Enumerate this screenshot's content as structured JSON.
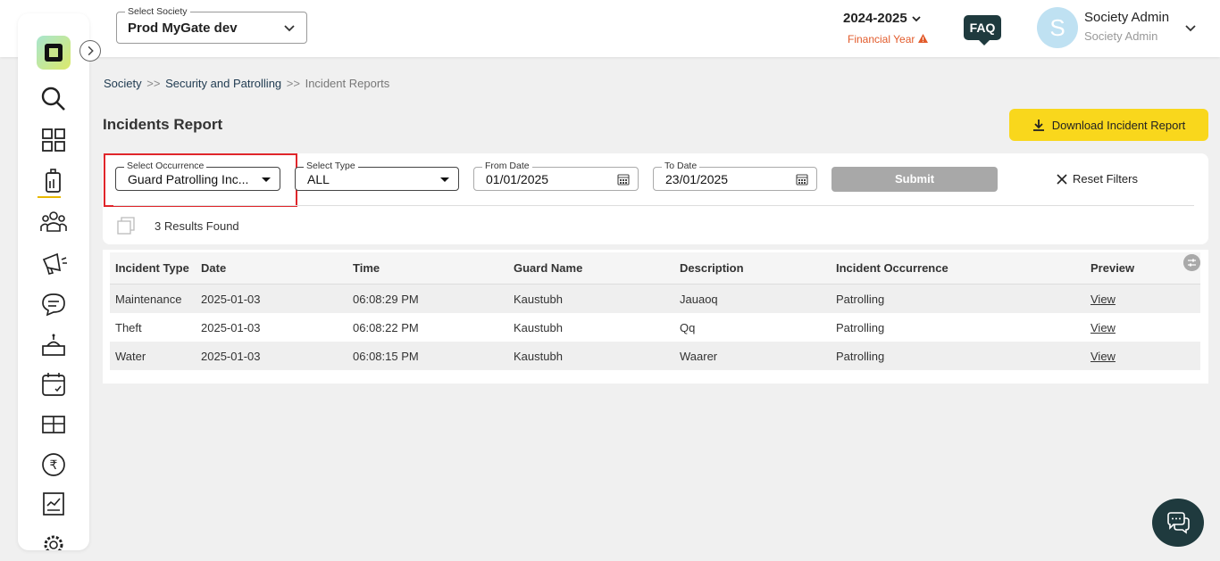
{
  "header": {
    "society_label": "Select Society",
    "society_value": "Prod MyGate dev",
    "financial_year": "2024-2025",
    "financial_year_label": "Financial Year",
    "faq_label": "FAQ",
    "avatar_letter": "S",
    "user_name": "Society Admin",
    "user_role": "Society Admin",
    "colors": {
      "accent": "#f9d71c",
      "dark": "#1f3a3e",
      "warning": "#e25b2b",
      "highlight": "#e0262b"
    }
  },
  "sidebar": {
    "icons": [
      "search-icon",
      "dashboard-icon",
      "security-icon",
      "residents-icon",
      "announcement-icon",
      "chat-icon",
      "amenity-icon",
      "calendar-icon",
      "inventory-icon",
      "rupee-icon",
      "reports-icon",
      "settings-icon"
    ]
  },
  "breadcrumb": {
    "items": [
      "Society",
      "Security and Patrolling",
      "Incident Reports"
    ],
    "separator": ">>"
  },
  "page": {
    "title": "Incidents Report",
    "download_label": "Download Incident Report"
  },
  "filters": {
    "occurrence": {
      "label": "Select Occurrence",
      "value": "Guard Patrolling Inc..."
    },
    "type": {
      "label": "Select Type",
      "value": "ALL"
    },
    "from_date": {
      "label": "From Date",
      "value": "01/01/2025"
    },
    "to_date": {
      "label": "To Date",
      "value": "23/01/2025"
    },
    "submit_label": "Submit",
    "reset_label": "Reset Filters"
  },
  "results_text": "3 Results Found",
  "table": {
    "columns": [
      "Incident Type",
      "Date",
      "Time",
      "Guard Name",
      "Description",
      "Incident Occurrence",
      "Preview"
    ],
    "rows": [
      [
        "Maintenance",
        "2025-01-03",
        "06:08:29 PM",
        "Kaustubh",
        "Jauaoq",
        "Patrolling",
        "View"
      ],
      [
        "Theft",
        "2025-01-03",
        "06:08:22 PM",
        "Kaustubh",
        "Qq",
        "Patrolling",
        "View"
      ],
      [
        "Water",
        "2025-01-03",
        "06:08:15 PM",
        "Kaustubh",
        "Waarer",
        "Patrolling",
        "View"
      ]
    ]
  }
}
